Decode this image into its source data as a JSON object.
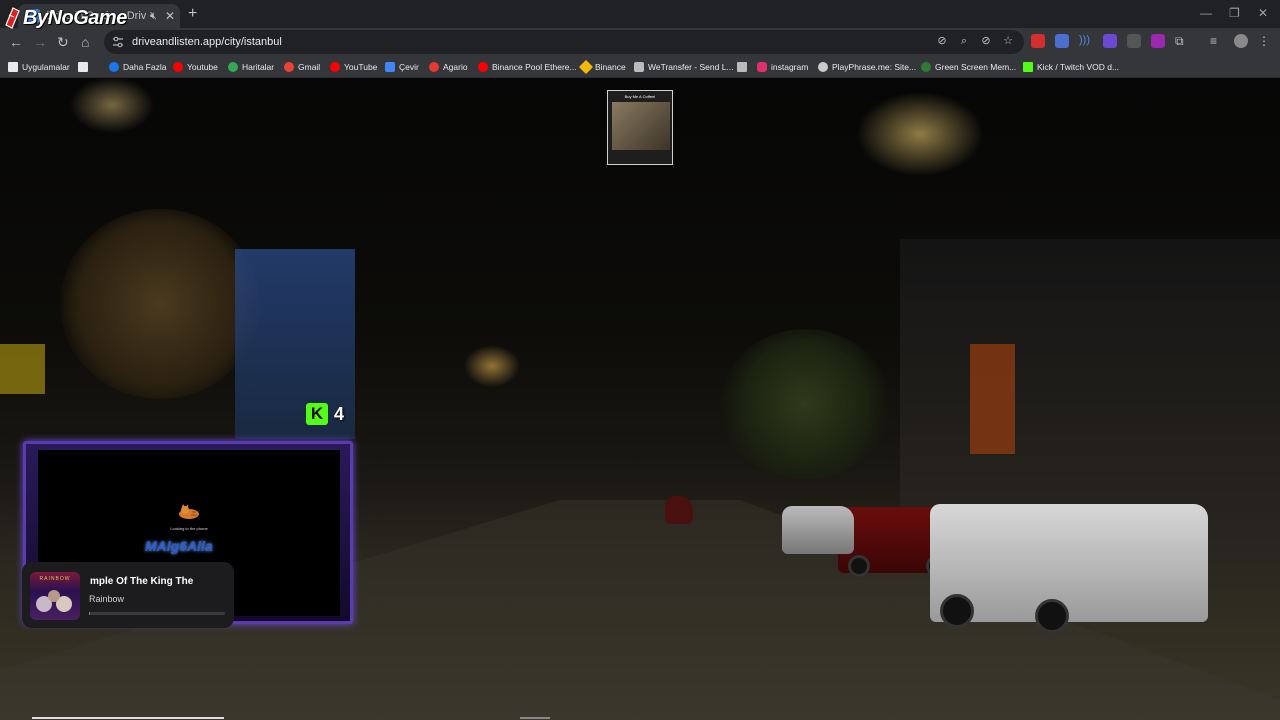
{
  "browser": {
    "tab_title": "Drive in Spain – Drive",
    "new_tab_symbol": "+",
    "url": "driveandlisten.app/city/istanbul",
    "window_controls": [
      "—",
      "❐",
      "✕"
    ]
  },
  "overlay_logo": "ByNoGame",
  "bookmarks": [
    {
      "label": "Uygulamalar",
      "icon": "apps-grid-icon",
      "color": "#e8eaed"
    },
    {
      "label": "",
      "icon": "grid-icon",
      "color": "#e8eaed"
    },
    {
      "label": "Daha Fazla",
      "icon": "facebook-icon",
      "color": "#1877f2"
    },
    {
      "label": "Youtube",
      "icon": "youtube-icon",
      "color": "#ff0000"
    },
    {
      "label": "Haritalar",
      "icon": "maps-icon",
      "color": "#34a853"
    },
    {
      "label": "Gmail",
      "icon": "gmail-icon",
      "color": "#ea4335"
    },
    {
      "label": "YouTube",
      "icon": "youtube-icon",
      "color": "#ff0000"
    },
    {
      "label": "Çevir",
      "icon": "translate-icon",
      "color": "#4285f4"
    },
    {
      "label": "Agario",
      "icon": "agario-icon",
      "color": "#e53935"
    },
    {
      "label": "Binance Pool Ethere...",
      "icon": "youtube-icon",
      "color": "#ff0000"
    },
    {
      "label": "Binance",
      "icon": "binance-icon",
      "color": "#f0b90b"
    },
    {
      "label": "WeTransfer - Send L...",
      "icon": "wetransfer-icon",
      "color": "#bbbbbb"
    },
    {
      "label": "",
      "icon": "bookmark-icon",
      "color": "#bbbbbb"
    },
    {
      "label": "instagram",
      "icon": "instagram-icon",
      "color": "#e1306c"
    },
    {
      "label": "PlayPhrase.me: Site...",
      "icon": "playphrase-icon",
      "color": "#cccccc"
    },
    {
      "label": "Green Screen Mem...",
      "icon": "greenscreen-icon",
      "color": "#2e7d32"
    },
    {
      "label": "Kick / Twitch VOD d...",
      "icon": "kick-icon",
      "color": "#53fc18"
    }
  ],
  "overlays": {
    "coffee_widget_title": "Buy Me A Coffee!",
    "kick_viewers": "4",
    "kick_letter": "K",
    "cam_status": "Looking to the phone",
    "cam_name": "MAlg6Alla"
  },
  "player": {
    "track": "mple Of The King       The",
    "artist": "Rainbow",
    "album_band": "RAINBOW",
    "progress": 0.01
  }
}
